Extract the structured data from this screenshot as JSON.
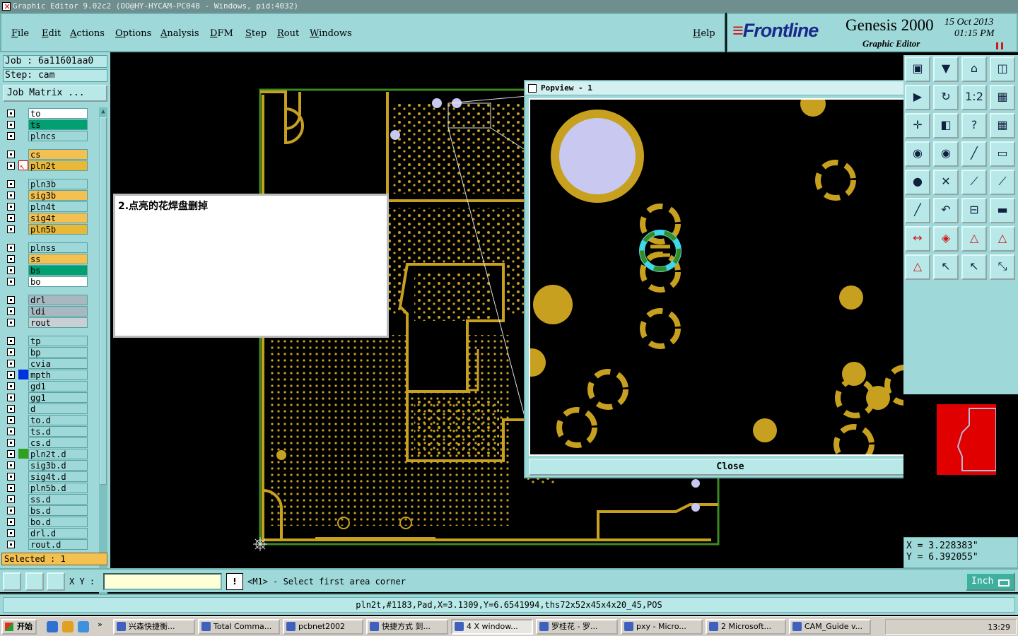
{
  "window": {
    "title": "Graphic Editor 9.02c2 (OO@HY-HYCAM-PC048 - Windows, pid:4032)"
  },
  "menu": {
    "items": [
      "File",
      "Edit",
      "Actions",
      "Options",
      "Analysis",
      "DFM",
      "Step",
      "Rout",
      "Windows"
    ],
    "help": "Help"
  },
  "brand": {
    "logo": "Frontline",
    "product": "Genesis 2000",
    "subtitle": "Graphic Editor",
    "date": "15 Oct 2013",
    "time": "01:15 PM"
  },
  "job": {
    "job_line": "Job : 6a11601aa0",
    "step_line": "Step: cam",
    "matrix_button": "Job Matrix ...",
    "selected": "Selected : 1"
  },
  "layers": [
    {
      "name": "to",
      "bg": "#ffffff",
      "mark": ""
    },
    {
      "name": "ts",
      "bg": "#00a070",
      "mark": ""
    },
    {
      "name": "plncs",
      "bg": "#9ed8d8",
      "mark": ""
    },
    {
      "name": "cs",
      "bg": "#f4c050",
      "mark": ""
    },
    {
      "name": "pln2t",
      "bg": "#e8b838",
      "mark": "work"
    },
    {
      "name": "pln3b",
      "bg": "#9ed8d8",
      "mark": ""
    },
    {
      "name": "sig3b",
      "bg": "#f4c050",
      "mark": ""
    },
    {
      "name": "pln4t",
      "bg": "#9ed8d8",
      "mark": ""
    },
    {
      "name": "sig4t",
      "bg": "#f4c050",
      "mark": ""
    },
    {
      "name": "pln5b",
      "bg": "#e8b838",
      "mark": ""
    },
    {
      "name": "plnss",
      "bg": "#9ed8d8",
      "mark": ""
    },
    {
      "name": "ss",
      "bg": "#f4c050",
      "mark": ""
    },
    {
      "name": "bs",
      "bg": "#00a070",
      "mark": ""
    },
    {
      "name": "bo",
      "bg": "#ffffff",
      "mark": ""
    },
    {
      "name": "drl",
      "bg": "#a8b8c0",
      "mark": ""
    },
    {
      "name": "ldi",
      "bg": "#a8b8c0",
      "mark": ""
    },
    {
      "name": "rout",
      "bg": "#c8d0d4",
      "mark": ""
    },
    {
      "name": "tp",
      "bg": "#9ed8d8",
      "mark": ""
    },
    {
      "name": "bp",
      "bg": "#9ed8d8",
      "mark": ""
    },
    {
      "name": "cvia",
      "bg": "#9ed8d8",
      "mark": ""
    },
    {
      "name": "mpth",
      "bg": "#9ed8d8",
      "mark": "blue"
    },
    {
      "name": "gd1",
      "bg": "#9ed8d8",
      "mark": ""
    },
    {
      "name": "gg1",
      "bg": "#9ed8d8",
      "mark": ""
    },
    {
      "name": "d",
      "bg": "#9ed8d8",
      "mark": ""
    },
    {
      "name": "to.d",
      "bg": "#9ed8d8",
      "mark": ""
    },
    {
      "name": "ts.d",
      "bg": "#9ed8d8",
      "mark": ""
    },
    {
      "name": "cs.d",
      "bg": "#9ed8d8",
      "mark": ""
    },
    {
      "name": "pln2t.d",
      "bg": "#9ed8d8",
      "mark": "green"
    },
    {
      "name": "sig3b.d",
      "bg": "#9ed8d8",
      "mark": ""
    },
    {
      "name": "sig4t.d",
      "bg": "#9ed8d8",
      "mark": ""
    },
    {
      "name": "pln5b.d",
      "bg": "#9ed8d8",
      "mark": ""
    },
    {
      "name": "ss.d",
      "bg": "#9ed8d8",
      "mark": ""
    },
    {
      "name": "bs.d",
      "bg": "#9ed8d8",
      "mark": ""
    },
    {
      "name": "bo.d",
      "bg": "#9ed8d8",
      "mark": ""
    },
    {
      "name": "drl.d",
      "bg": "#9ed8d8",
      "mark": ""
    },
    {
      "name": "rout.d",
      "bg": "#9ed8d8",
      "mark": ""
    }
  ],
  "annotation": {
    "text": "2.点亮的花焊盘删掉"
  },
  "popview": {
    "title": "Popview - 1",
    "close_label": "Close"
  },
  "coords": {
    "x": "X = 3.228383\"",
    "y": "Y = 6.392055\""
  },
  "command": {
    "xy_label": "X Y :",
    "xy_value": "",
    "prompt": "<M1> - Select first area corner",
    "unit": "Inch"
  },
  "info": {
    "text": "pln2t,#1183,Pad,X=3.1309,Y=6.6541994,ths72x52x45x4x20_45,POS"
  },
  "taskbar": {
    "start": "开始",
    "tasks": [
      "兴森快捷衡...",
      "Total Comma...",
      "pcbnet2002",
      "快捷方式 到...",
      "4 X window...",
      "罗桂花 - 罗...",
      "pxy - Micro...",
      "2 Microsoft...",
      "CAM_Guide v..."
    ],
    "clock": "13:29"
  },
  "colors": {
    "panel": "#9ed8d8",
    "copper": "#c8a020",
    "outline": "#3a8a20",
    "highlight": "#40d8e8",
    "accent": "#f4c050"
  }
}
